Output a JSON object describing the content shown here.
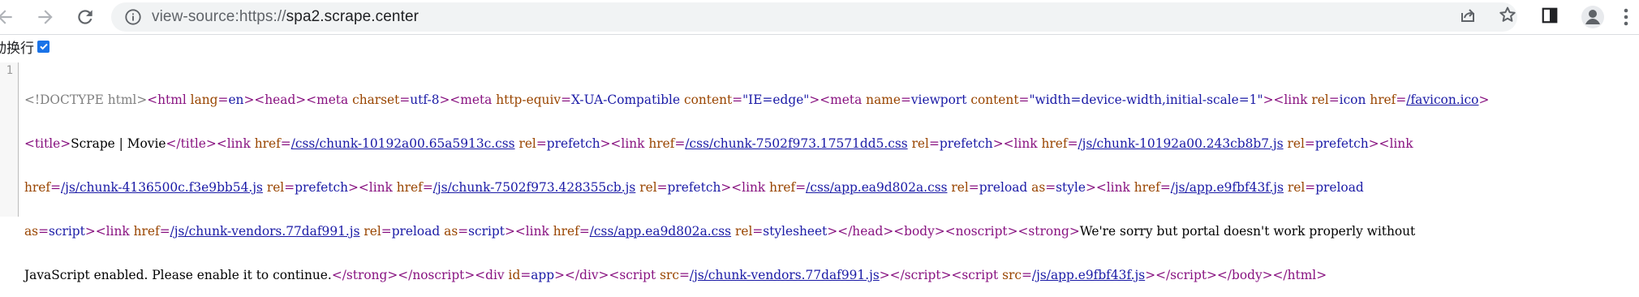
{
  "browser": {
    "url_scheme": "view-source:https://",
    "url_host": "spa2.scrape.center",
    "icons": [
      "back-icon",
      "forward-icon",
      "reload-icon",
      "info-icon",
      "share-icon",
      "star-icon",
      "side-panel-icon",
      "profile-icon",
      "menu-icon"
    ]
  },
  "wrap": {
    "label": "动换行",
    "checked": true
  },
  "source": {
    "line_number": "1",
    "colors": {
      "tag": "#881280",
      "attr": "#994500",
      "value": "#1a1aa6",
      "comment": "#808080"
    }
  }
}
